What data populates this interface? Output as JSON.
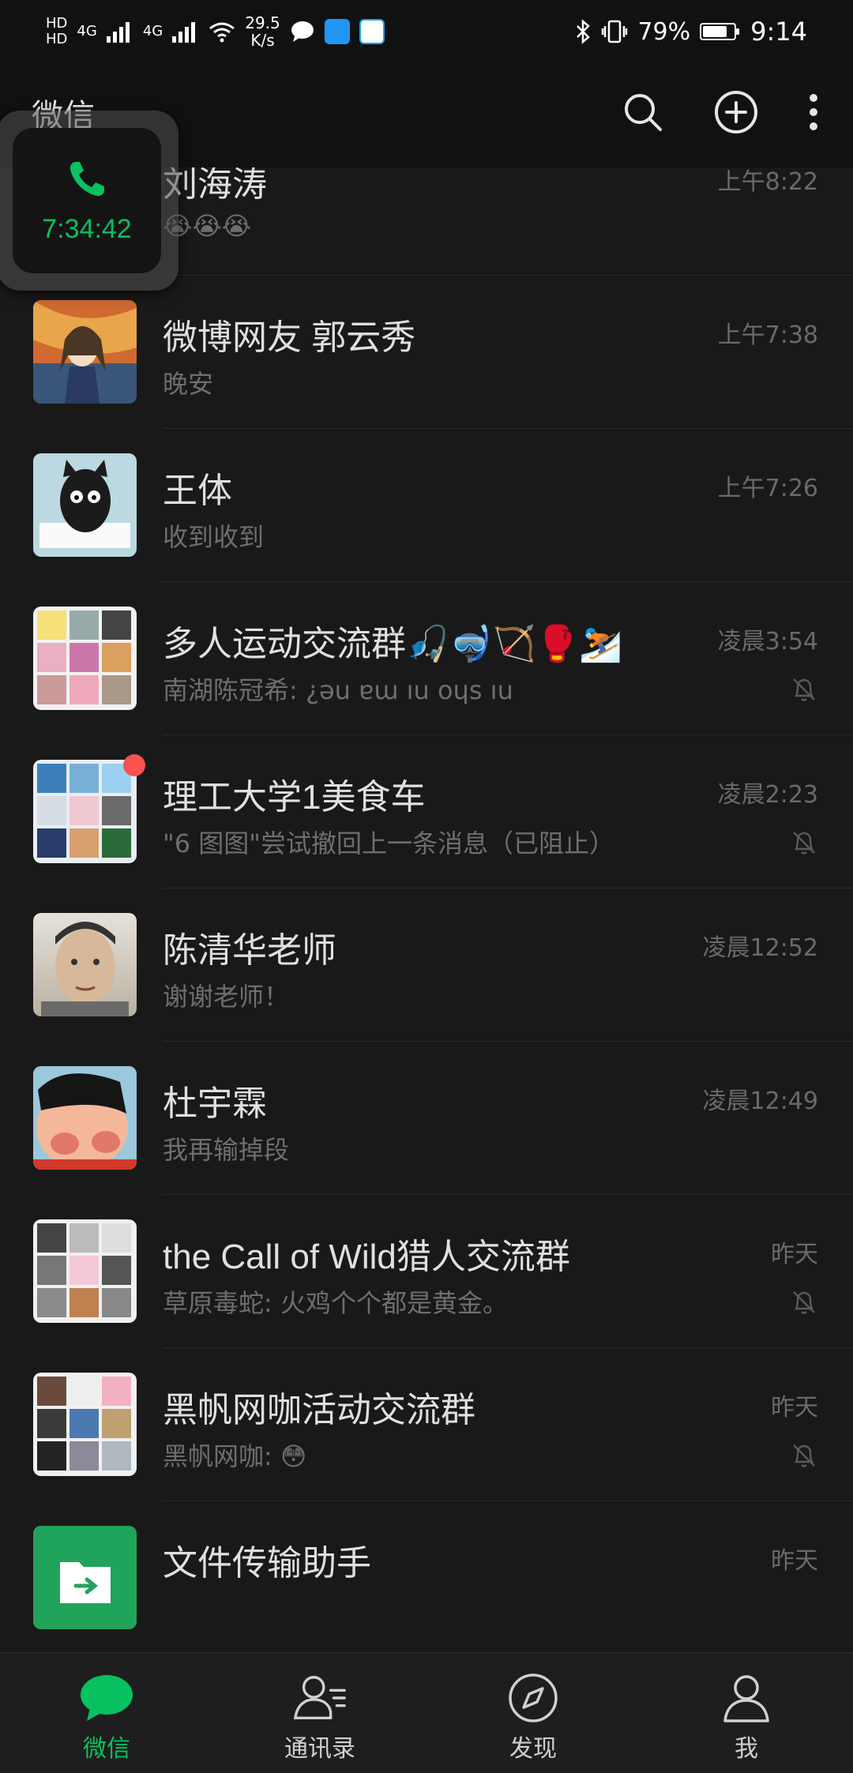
{
  "status_bar": {
    "hd1": "HD",
    "hd2": "HD",
    "net1": "4G",
    "net2": "4G",
    "speed_value": "29.5",
    "speed_unit": "K/s",
    "battery_pct": "79%",
    "battery_level": 0.79,
    "time": "9:14"
  },
  "header": {
    "title": "微信"
  },
  "call_float": {
    "duration": "7:34:42"
  },
  "chats": [
    {
      "name": "刘海涛",
      "message": "😭😭😭",
      "time": "上午8:22",
      "muted": false
    },
    {
      "name": "微博网友 郭云秀",
      "message": "晚安",
      "time": "上午7:38",
      "muted": false
    },
    {
      "name": "王体",
      "message": "收到收到",
      "time": "上午7:26",
      "muted": false
    },
    {
      "name": "多人运动交流群🎣🤿🏹🥊⛷️",
      "message": "南湖陈冠希: ¿ǝu ɐɯ ıu oɥs ıu",
      "time": "凌晨3:54",
      "muted": true
    },
    {
      "name": "理工大学1美食车",
      "message": "\"6   图图\"尝试撤回上一条消息（已阻止）",
      "time": "凌晨2:23",
      "muted": true
    },
    {
      "name": "陈清华老师",
      "message": "谢谢老师！",
      "time": "凌晨12:52",
      "muted": false
    },
    {
      "name": "杜宇霖",
      "message": "我再输掉段",
      "time": "凌晨12:49",
      "muted": false
    },
    {
      "name": "the Call of Wild猎人交流群",
      "message": "草原毒蛇: 火鸡个个都是黄金。",
      "time": "昨天",
      "muted": true
    },
    {
      "name": "黑帆网咖活动交流群",
      "message": "黑帆网咖: 😳",
      "time": "昨天",
      "muted": true
    },
    {
      "name": "文件传输助手",
      "message": "",
      "time": "昨天",
      "muted": false
    }
  ],
  "tabs": [
    {
      "label": "微信",
      "active": true
    },
    {
      "label": "通讯录",
      "active": false
    },
    {
      "label": "发现",
      "active": false
    },
    {
      "label": "我",
      "active": false
    }
  ],
  "colors": {
    "accent": "#07c160",
    "badge": "#fa5151",
    "background": "#191919"
  }
}
